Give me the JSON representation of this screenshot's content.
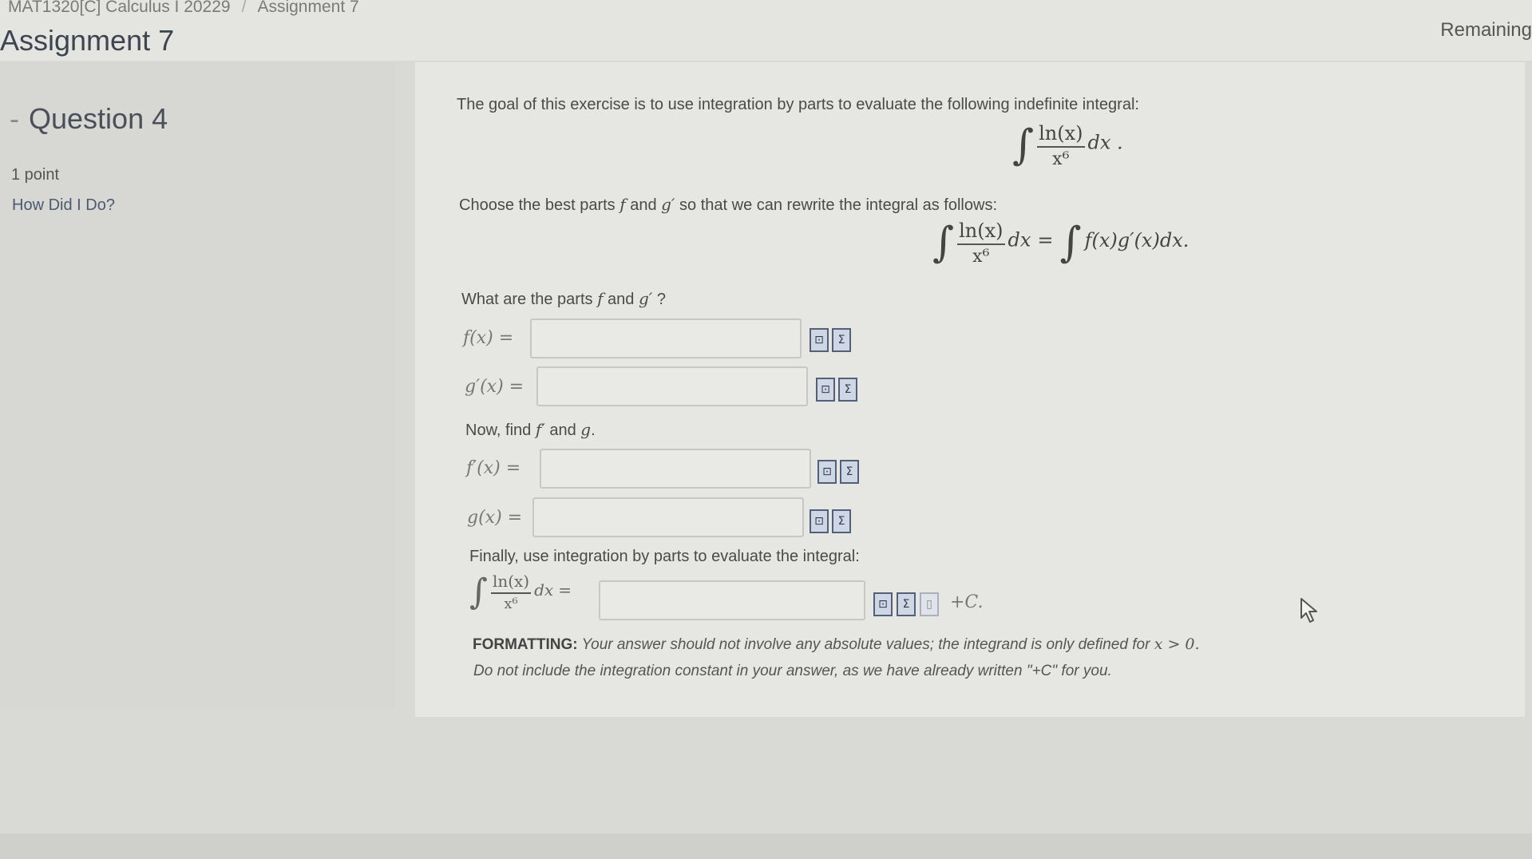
{
  "breadcrumb": {
    "course": "MAT1320[C] Calculus I 20229",
    "current": "Assignment 7"
  },
  "title": "Assignment 7",
  "remaining": "Remaining",
  "sidebar": {
    "dash": "-",
    "question": "Question 4",
    "points": "1 point",
    "how_did": "How Did I Do?"
  },
  "question": {
    "intro": "The goal of this exercise is to use integration by parts to evaluate the following indefinite integral:",
    "choose_pre": "Choose the best parts ",
    "choose_and": " and ",
    "choose_post": " so that we can rewrite the integral as follows:",
    "what_pre": "What are the parts ",
    "what_and": " and ",
    "what_post": " ?",
    "now_pre": "Now, find ",
    "now_and": " and ",
    "now_post": ".",
    "finally": "Finally, use integration by parts to evaluate the integral:",
    "formatting_label": "FORMATTING:",
    "formatting_1": "Your answer should not involve any absolute values; the integrand is only defined for ",
    "formatting_cond": "x > 0.",
    "formatting_2": "Do not include the integration constant in your answer, as we have already written \"+C\" for you."
  },
  "math": {
    "integral": "∫",
    "numerator": "ln(x)",
    "denominator": "x⁶",
    "dx": "dx",
    "dx_dot": "dx .",
    "equals": "=",
    "rhs": "f(x)g′(x)dx.",
    "f": "f",
    "gp": "g′",
    "fp": "f′",
    "g": "g",
    "plus_c": "+C."
  },
  "inputs": {
    "f": {
      "label": "f(x) =",
      "value": ""
    },
    "gp": {
      "label": "g′(x) =",
      "value": ""
    },
    "fp": {
      "label": "f′(x) =",
      "value": ""
    },
    "g": {
      "label": "g(x) =",
      "value": ""
    },
    "final": {
      "value": ""
    }
  },
  "icons": {
    "preview": "⊡",
    "equation": "Σ",
    "blank": "▯"
  }
}
